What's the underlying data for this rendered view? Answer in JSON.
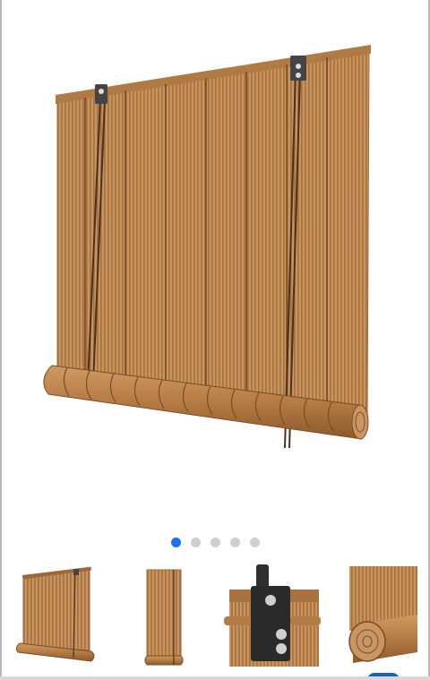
{
  "gallery": {
    "main_image_icon": "bamboo-roller-blind-image",
    "dot_count": 5,
    "active_dot": 0,
    "thumbnails": [
      {
        "icon": "blind-angle-thumbnail"
      },
      {
        "icon": "blind-front-thumbnail"
      },
      {
        "icon": "blind-bracket-closeup-thumbnail"
      },
      {
        "icon": "blind-rolled-closeup-thumbnail"
      }
    ]
  },
  "colors": {
    "accent": "#1a73e8",
    "inactive_dot": "#cfcfcf",
    "bamboo": "#b9834e",
    "bamboo_dark": "#8a5a2e",
    "cord": "#4a3020"
  }
}
